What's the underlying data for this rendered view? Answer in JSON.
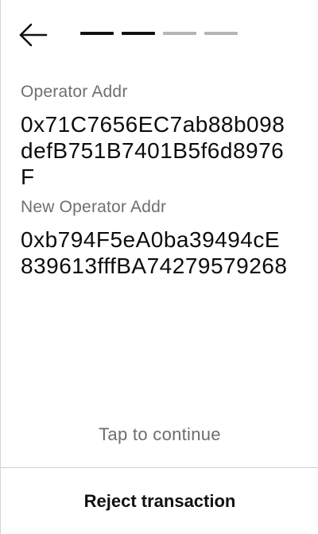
{
  "header": {
    "back_icon": "arrow-left-icon",
    "progress": {
      "total_steps": 4,
      "completed_steps": 2,
      "active_color": "#111111",
      "inactive_color": "#b5b5b5"
    }
  },
  "fields": [
    {
      "label": "Operator Addr",
      "value": "0x71C7656EC7ab88b098defB751B7401B5f6d8976F"
    },
    {
      "label": "New Operator Addr",
      "value": "0xb794F5eA0ba39494cE839613fffBA74279579268"
    }
  ],
  "footer": {
    "tap_label": "Tap to continue",
    "reject_label": "Reject transaction"
  }
}
